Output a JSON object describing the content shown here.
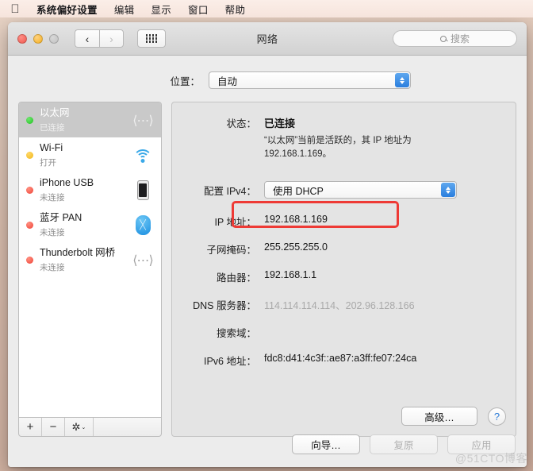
{
  "menubar": {
    "apple_glyph": "",
    "items": [
      {
        "label": "系统偏好设置"
      },
      {
        "label": "编辑"
      },
      {
        "label": "显示"
      },
      {
        "label": "窗口"
      },
      {
        "label": "帮助"
      }
    ]
  },
  "window": {
    "title": "网络",
    "nav": {
      "back": "‹",
      "forward": "›"
    },
    "search": {
      "placeholder": "搜索",
      "value": ""
    }
  },
  "location": {
    "label": "位置：",
    "selected": "自动"
  },
  "sidebar": {
    "items": [
      {
        "name": "以太网",
        "status": "已连接",
        "dot": "green",
        "icon": "bridge-icon",
        "selected": true
      },
      {
        "name": "Wi-Fi",
        "status": "打开",
        "dot": "yellow",
        "icon": "wifi-icon",
        "selected": false
      },
      {
        "name": "iPhone USB",
        "status": "未连接",
        "dot": "red",
        "icon": "iphone-icon",
        "selected": false
      },
      {
        "name": "蓝牙 PAN",
        "status": "未连接",
        "dot": "red",
        "icon": "bluetooth-icon",
        "selected": false
      },
      {
        "name": "Thunderbolt 网桥",
        "status": "未连接",
        "dot": "red",
        "icon": "bridge-icon",
        "selected": false
      }
    ],
    "footer": {
      "add": "+",
      "remove": "−",
      "gear": "✲",
      "gear_chevron": "⌄"
    }
  },
  "panel": {
    "status": {
      "label": "状态：",
      "value": "已连接",
      "description": "“以太网”当前是活跃的，其 IP 地址为 192.168.1.169。"
    },
    "fields": [
      {
        "label": "配置 IPv4：",
        "value": "使用 DHCP",
        "type": "popup"
      },
      {
        "label": "IP 地址：",
        "value": "192.168.1.169",
        "type": "text",
        "highlighted": true
      },
      {
        "label": "子网掩码：",
        "value": "255.255.255.0",
        "type": "text"
      },
      {
        "label": "路由器：",
        "value": "192.168.1.1",
        "type": "text"
      },
      {
        "label": "DNS 服务器：",
        "value": "114.114.114.114、202.96.128.166",
        "type": "text",
        "dim": true
      },
      {
        "label": "搜索域：",
        "value": "",
        "type": "text"
      },
      {
        "label": "IPv6 地址：",
        "value": "fdc8:d41:4c3f::ae87:a3ff:fe07:24ca",
        "type": "text"
      }
    ],
    "advanced_label": "高级…",
    "help_label": "?"
  },
  "footer": {
    "assist_label": "向导…",
    "revert_label": "复原",
    "apply_label": "应用"
  },
  "watermark": "@51CTO博客",
  "colors": {
    "accent_blue": "#2a7ede",
    "annotation_red": "#ee3a35",
    "selected_row": "#c9c9c9"
  }
}
